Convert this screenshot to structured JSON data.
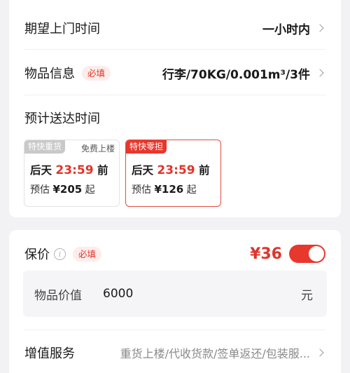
{
  "pickup": {
    "label": "期望上门时间",
    "value": "一小时内"
  },
  "goods": {
    "label": "物品信息",
    "required": "必填",
    "value": "行李/70KG/0.001m³/3件"
  },
  "delivery": {
    "label": "预计送达时间",
    "options": [
      {
        "tag": "特快重货",
        "extra": "免费上楼",
        "eta_prefix": "后天",
        "eta_time": "23:59",
        "eta_suffix": "前",
        "price_prefix": "预估",
        "price": "¥205",
        "price_suffix": "起",
        "selected": false
      },
      {
        "tag": "特快零担",
        "extra": "",
        "eta_prefix": "后天",
        "eta_time": "23:59",
        "eta_suffix": "前",
        "price_prefix": "预估",
        "price": "¥126",
        "price_suffix": "起",
        "selected": true
      }
    ]
  },
  "insurance": {
    "label": "保价",
    "required": "必填",
    "price": "¥36",
    "enabled": true,
    "value_label": "物品价值",
    "value_amount": "6000",
    "value_unit": "元"
  },
  "addons": {
    "label": "增值服务",
    "value": "重货上楼/代收货款/签单返还/包装服..."
  },
  "colors": {
    "accent": "#e8372c",
    "background": "#f2f2f4"
  }
}
